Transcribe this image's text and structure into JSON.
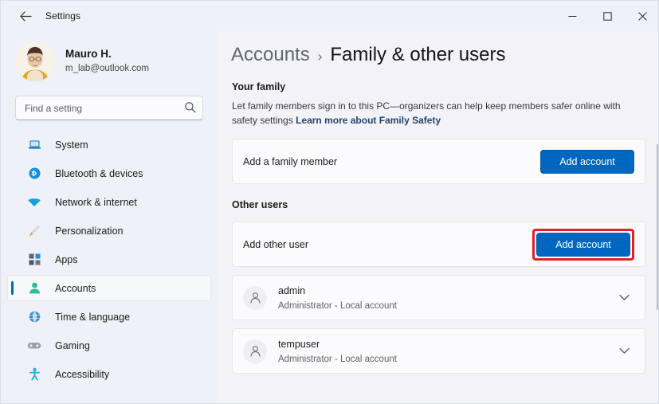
{
  "window": {
    "title": "Settings",
    "back_icon": "back-arrow-icon",
    "controls": [
      {
        "name": "minimize",
        "glyph": "minimize-icon"
      },
      {
        "name": "maximize",
        "glyph": "maximize-icon"
      },
      {
        "name": "close",
        "glyph": "close-icon"
      }
    ]
  },
  "sidebar": {
    "profile": {
      "name": "Mauro H.",
      "email": "m_lab@outlook.com",
      "avatar_icon": "user-avatar-photo"
    },
    "search": {
      "placeholder": "Find a setting",
      "value": "",
      "icon": "search-icon"
    },
    "items": [
      {
        "label": "System",
        "icon": "laptop-icon",
        "selected": false
      },
      {
        "label": "Bluetooth & devices",
        "icon": "bluetooth-icon",
        "selected": false
      },
      {
        "label": "Network & internet",
        "icon": "wifi-icon",
        "selected": false
      },
      {
        "label": "Personalization",
        "icon": "paintbrush-icon",
        "selected": false
      },
      {
        "label": "Apps",
        "icon": "apps-grid-icon",
        "selected": false
      },
      {
        "label": "Accounts",
        "icon": "person-icon",
        "selected": true
      },
      {
        "label": "Time & language",
        "icon": "clock-globe-icon",
        "selected": false
      },
      {
        "label": "Gaming",
        "icon": "game-controller-icon",
        "selected": false
      },
      {
        "label": "Accessibility",
        "icon": "accessibility-icon",
        "selected": false
      }
    ]
  },
  "main": {
    "breadcrumb": {
      "parent": "Accounts",
      "separator": "›",
      "current": "Family & other users"
    },
    "family_section": {
      "title": "Your family",
      "description": "Let family members sign in to this PC—organizers can help keep members safer online with safety settings",
      "link": "Learn more about Family Safety",
      "card_label": "Add a family member",
      "card_button": "Add account"
    },
    "other_section": {
      "title": "Other users",
      "card_label": "Add other user",
      "card_button": "Add account",
      "users": [
        {
          "name": "admin",
          "subtitle": "Administrator - Local account",
          "avatar_icon": "person-icon",
          "expander_icon": "chevron-down-icon"
        },
        {
          "name": "tempuser",
          "subtitle": "Administrator - Local account",
          "avatar_icon": "person-icon",
          "expander_icon": "chevron-down-icon"
        }
      ]
    }
  },
  "colors": {
    "accent": "#0067c0",
    "highlight": "#e12029",
    "background": "#f3f3f7",
    "sidebar": "#eef1f7",
    "card": "#fbfbfd",
    "link": "#20456e"
  }
}
